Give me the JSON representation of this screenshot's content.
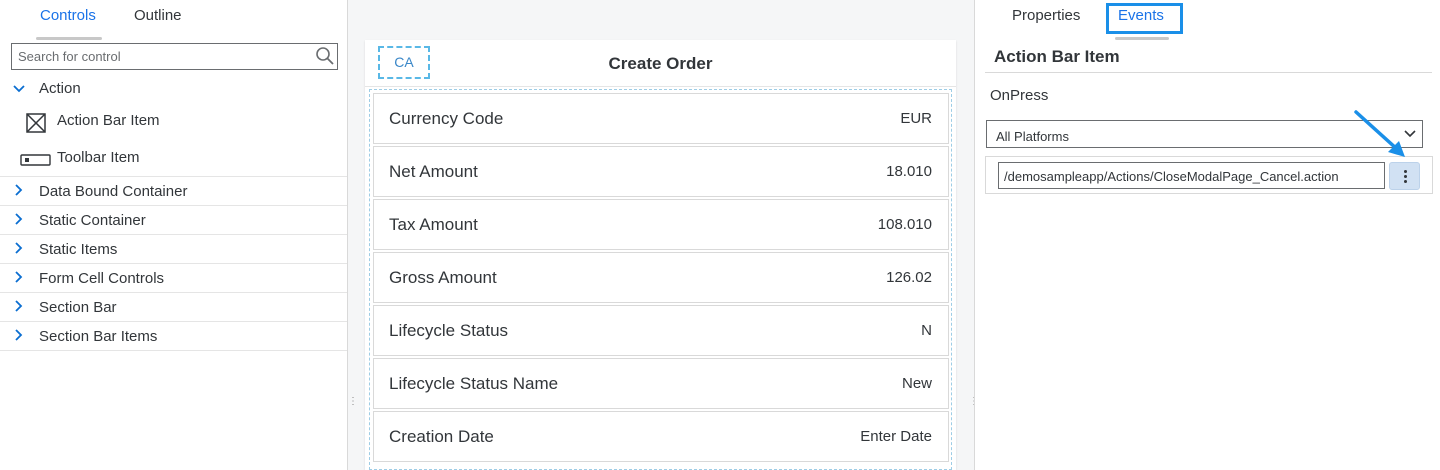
{
  "left_panel": {
    "tabs": [
      {
        "label": "Controls",
        "active": true
      },
      {
        "label": "Outline",
        "active": false
      }
    ],
    "search": {
      "placeholder": "Search for control",
      "value": ""
    },
    "tree": {
      "action_group": {
        "label": "Action",
        "expanded": true,
        "children": [
          {
            "label": "Action Bar Item",
            "icon": "action-bar-item-icon"
          },
          {
            "label": "Toolbar Item",
            "icon": "toolbar-item-icon"
          }
        ]
      },
      "groups": [
        {
          "label": "Data Bound Container"
        },
        {
          "label": "Static Container"
        },
        {
          "label": "Static Items"
        },
        {
          "label": "Form Cell Controls"
        },
        {
          "label": "Section Bar"
        },
        {
          "label": "Section Bar Items"
        }
      ]
    }
  },
  "canvas": {
    "header": {
      "action_item_label": "CA",
      "title": "Create Order"
    },
    "form_cells": [
      {
        "label": "Currency Code",
        "value": "EUR"
      },
      {
        "label": "Net Amount",
        "value": "18.010"
      },
      {
        "label": "Tax Amount",
        "value": "108.010"
      },
      {
        "label": "Gross Amount",
        "value": "126.02"
      },
      {
        "label": "Lifecycle Status",
        "value": "N"
      },
      {
        "label": "Lifecycle Status Name",
        "value": "New"
      },
      {
        "label": "Creation Date",
        "value": "Enter Date"
      }
    ]
  },
  "right_panel": {
    "tabs": [
      {
        "label": "Properties",
        "active": false
      },
      {
        "label": "Events",
        "active": true
      }
    ],
    "title": "Action Bar Item",
    "event_label": "OnPress",
    "platform_select": {
      "value": "All Platforms"
    },
    "action_path": "/demosampleapp/Actions/CloseModalPage_Cancel.action"
  },
  "colors": {
    "accent": "#1a73e8",
    "highlight_box": "#1a8fe8",
    "dashed_outline": "#59b8e6",
    "more_button_bg": "#d1e1f3"
  }
}
